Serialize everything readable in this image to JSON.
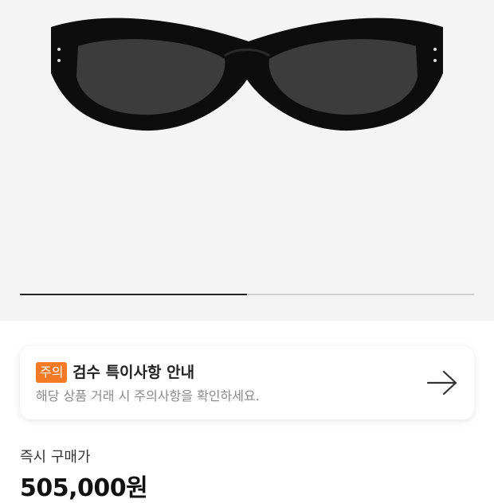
{
  "hero": {
    "image_icon": "sunglasses-icon",
    "carousel_progress": 0.5
  },
  "notice": {
    "badge": "주의",
    "title": "검수 특이사항 안내",
    "description": "해당 상품 거래 시 주의사항을 확인하세요.",
    "arrow_icon": "arrow-right-icon",
    "badge_color": "#f47a25"
  },
  "price": {
    "label": "즉시 구매가",
    "value": "505,000원"
  }
}
